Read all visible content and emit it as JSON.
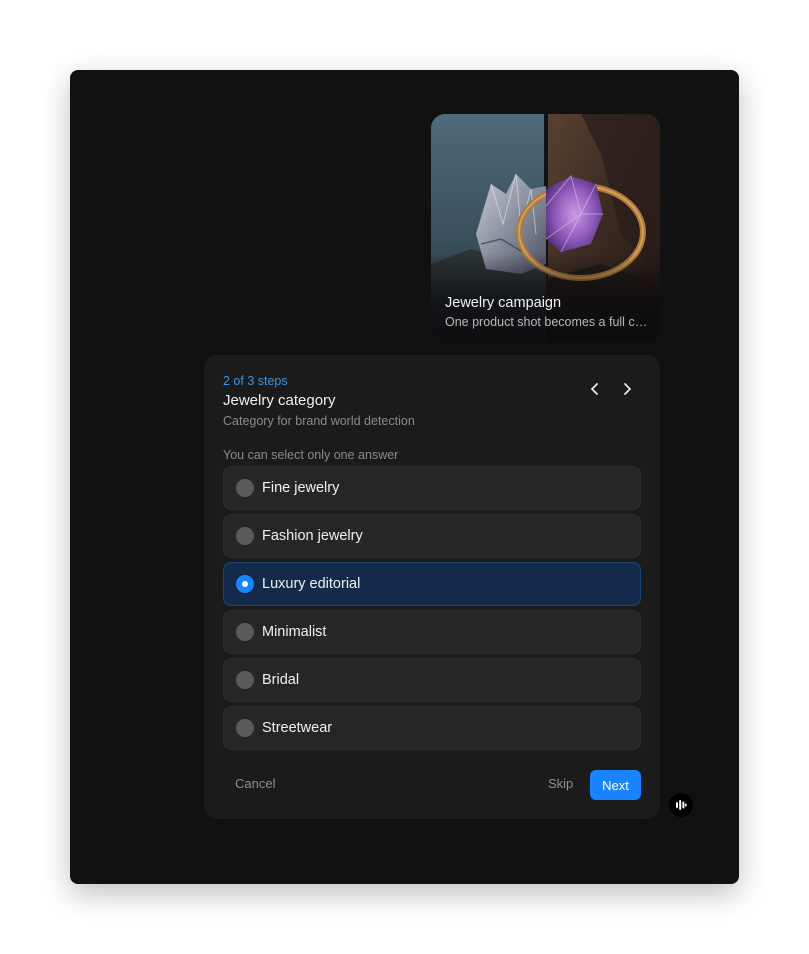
{
  "media_card": {
    "title": "Jewelry campaign",
    "subtitle": "One product shot becomes a full campaign"
  },
  "question": {
    "step_indicator": "2 of 3 steps",
    "title": "Jewelry category",
    "description": "Category for brand world detection",
    "hint": "You can select only one answer",
    "options": [
      {
        "label": "Fine jewelry",
        "selected": false
      },
      {
        "label": "Fashion jewelry",
        "selected": false
      },
      {
        "label": "Luxury editorial",
        "selected": true
      },
      {
        "label": "Minimalist",
        "selected": false
      },
      {
        "label": "Bridal",
        "selected": false
      },
      {
        "label": "Streetwear",
        "selected": false
      }
    ]
  },
  "icons": {
    "prev": "chevron-left-icon",
    "next": "chevron-right-icon",
    "assistant": "audio-bars-icon"
  },
  "actions": {
    "cancel_label": "Cancel",
    "skip_label": "Skip",
    "next_label": "Next"
  },
  "colors": {
    "accent": "#1a84ff",
    "step_indicator": "#3b95e0",
    "selected_option_bg": "#142a4a"
  }
}
